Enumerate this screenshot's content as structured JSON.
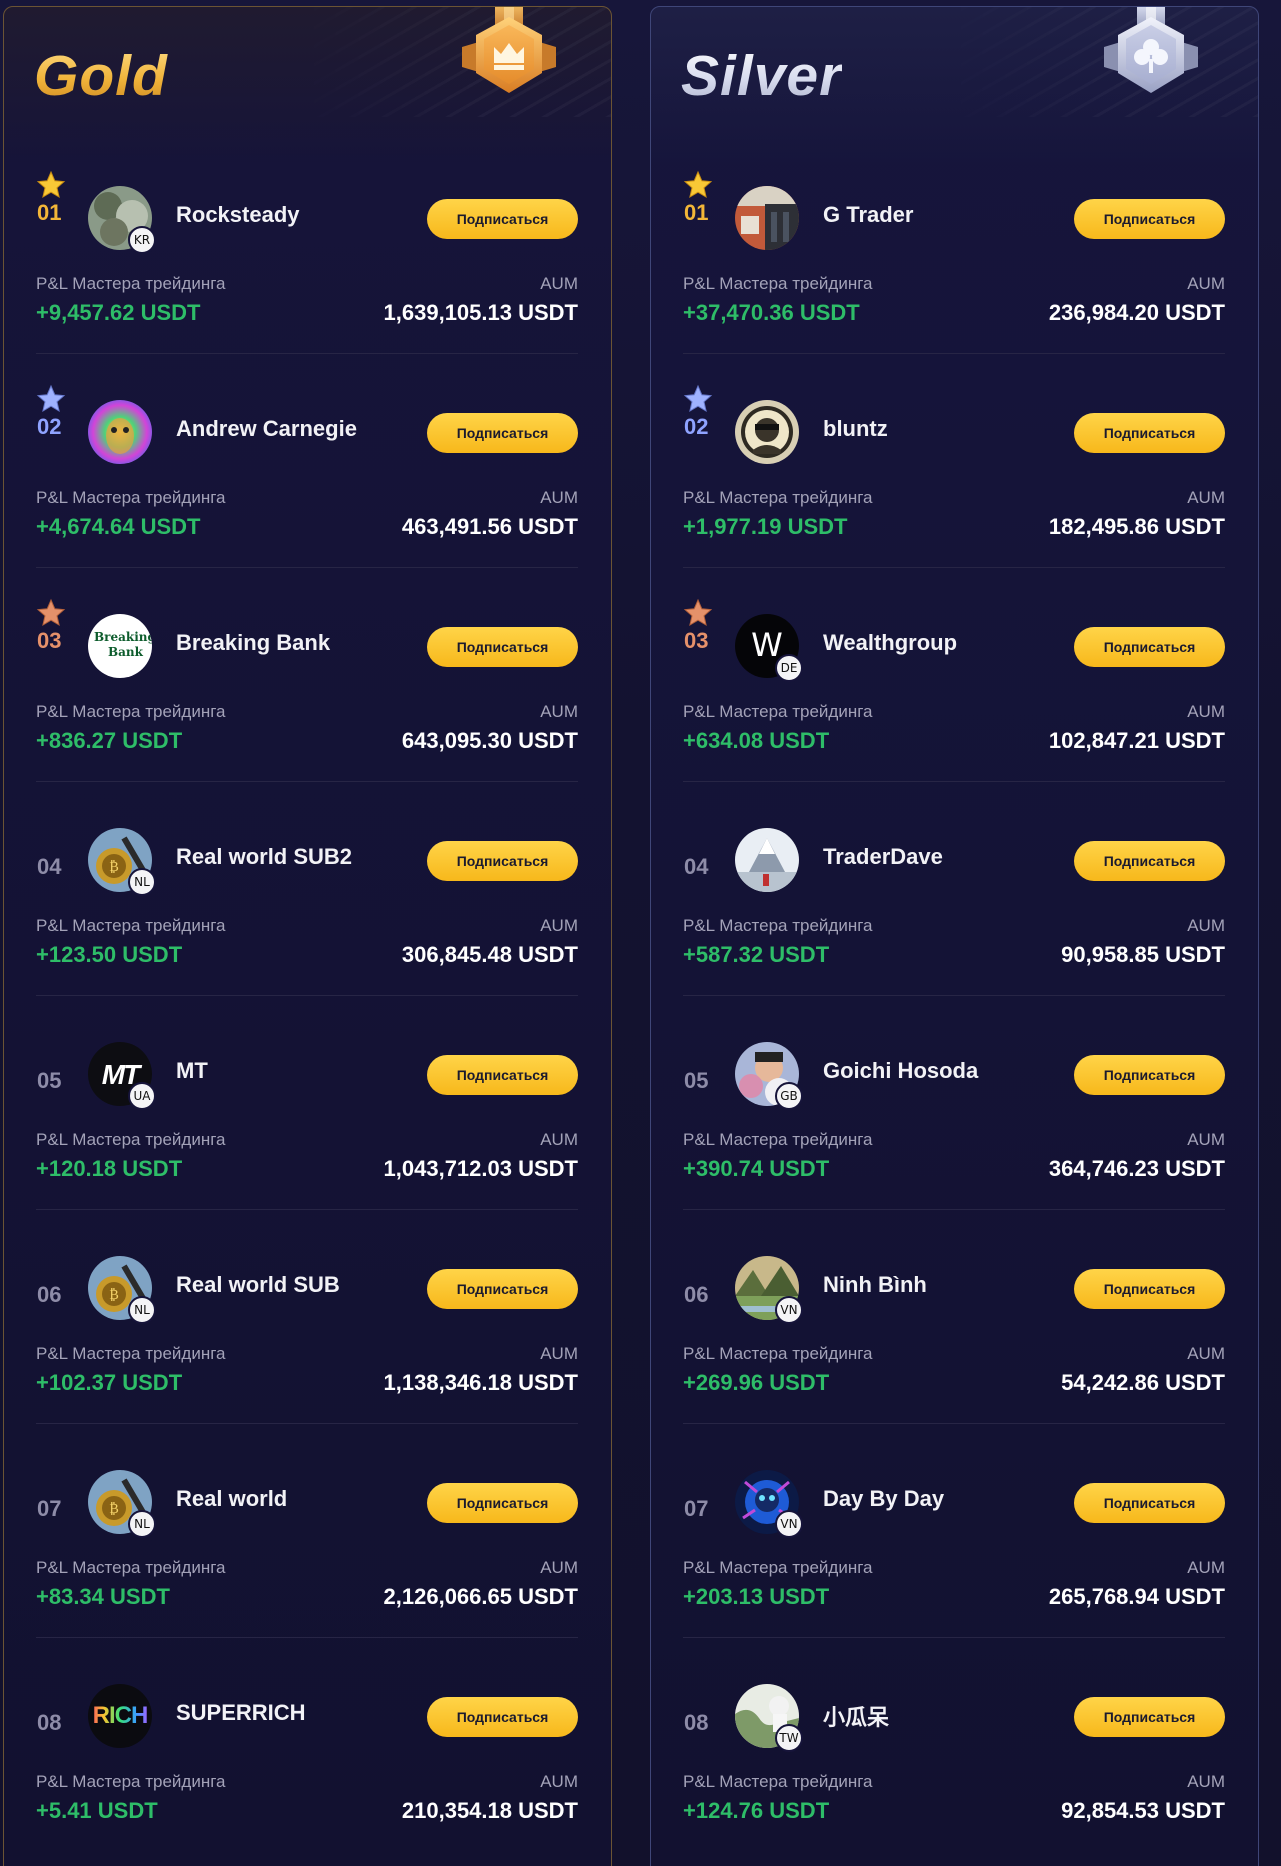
{
  "colors": {
    "gold_accent": "#f3b638",
    "silver_accent": "#d7dbee",
    "profit_green": "#2ebd68",
    "subscribe_yellow": "#f7b81b",
    "background": "#12112c"
  },
  "common": {
    "subscribe_label": "Подписаться",
    "pnl_label": "P&L Мастера трейдинга",
    "aum_label": "AUM"
  },
  "gold": {
    "title": "Gold",
    "medal_icon": "crown-medal-icon",
    "traders": [
      {
        "rank": "01",
        "name": "Rocksteady",
        "country": "KR",
        "pnl": "+9,457.62 USDT",
        "aum": "1,639,105.13 USDT",
        "star": "gold-star-icon"
      },
      {
        "rank": "02",
        "name": "Andrew Carnegie",
        "country": "",
        "pnl": "+4,674.64 USDT",
        "aum": "463,491.56 USDT",
        "star": "silver-star-icon"
      },
      {
        "rank": "03",
        "name": "Breaking Bank",
        "country": "",
        "pnl": "+836.27 USDT",
        "aum": "643,095.30 USDT",
        "star": "bronze-star-icon",
        "avatar_text_top": "Breaking",
        "avatar_text_bottom": "Bank"
      },
      {
        "rank": "04",
        "name": "Real world SUB2",
        "country": "NL",
        "pnl": "+123.50 USDT",
        "aum": "306,845.48 USDT"
      },
      {
        "rank": "05",
        "name": "MT",
        "country": "UA",
        "pnl": "+120.18 USDT",
        "aum": "1,043,712.03 USDT",
        "avatar_text": "MT"
      },
      {
        "rank": "06",
        "name": "Real world SUB",
        "country": "NL",
        "pnl": "+102.37 USDT",
        "aum": "1,138,346.18 USDT"
      },
      {
        "rank": "07",
        "name": "Real world",
        "country": "NL",
        "pnl": "+83.34 USDT",
        "aum": "2,126,066.65 USDT"
      },
      {
        "rank": "08",
        "name": "SUPERRICH",
        "country": "",
        "pnl": "+5.41 USDT",
        "aum": "210,354.18 USDT",
        "avatar_text": "RICH"
      }
    ]
  },
  "silver": {
    "title": "Silver",
    "medal_icon": "clover-medal-icon",
    "traders": [
      {
        "rank": "01",
        "name": "G Trader",
        "country": "",
        "pnl": "+37,470.36 USDT",
        "aum": "236,984.20 USDT",
        "star": "gold-star-icon"
      },
      {
        "rank": "02",
        "name": "bluntz",
        "country": "",
        "pnl": "+1,977.19 USDT",
        "aum": "182,495.86 USDT",
        "star": "silver-star-icon"
      },
      {
        "rank": "03",
        "name": "Wealthgroup",
        "country": "DE",
        "pnl": "+634.08 USDT",
        "aum": "102,847.21 USDT",
        "star": "bronze-star-icon",
        "avatar_text": "W"
      },
      {
        "rank": "04",
        "name": "TraderDave",
        "country": "",
        "pnl": "+587.32 USDT",
        "aum": "90,958.85 USDT"
      },
      {
        "rank": "05",
        "name": "Goichi Hosoda",
        "country": "GB",
        "pnl": "+390.74 USDT",
        "aum": "364,746.23 USDT"
      },
      {
        "rank": "06",
        "name": "Ninh Bình",
        "country": "VN",
        "pnl": "+269.96 USDT",
        "aum": "54,242.86 USDT"
      },
      {
        "rank": "07",
        "name": "Day By Day",
        "country": "VN",
        "pnl": "+203.13 USDT",
        "aum": "265,768.94 USDT"
      },
      {
        "rank": "08",
        "name": "小瓜呆",
        "country": "TW",
        "pnl": "+124.76 USDT",
        "aum": "92,854.53 USDT"
      }
    ]
  }
}
